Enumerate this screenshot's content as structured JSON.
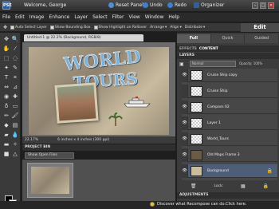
{
  "titlebar": {
    "app_icon": "PSE",
    "user": "Welcome, George",
    "reset_panels": "Reset Panels",
    "undo": "Undo",
    "redo": "Redo",
    "organizer": "Organizer"
  },
  "menu": [
    "File",
    "Edit",
    "Image",
    "Enhance",
    "Layer",
    "Select",
    "Filter",
    "View",
    "Window",
    "Help"
  ],
  "options": {
    "auto_select": "Auto Select Layer",
    "show_bounding": "Show Bounding Box",
    "show_highlight": "Show Highlight on Rollover",
    "arrange": "Arrange",
    "align": "Align",
    "distribute": "Distribute",
    "edit_tab": "Edit"
  },
  "document": {
    "tab_title": "Untitled-1 @ 22.2% (Background, RGB/8)",
    "artwork_text_1": "WORLD",
    "artwork_text_2": "TOURS",
    "zoom": "22.17%",
    "doc_info": "6 inches x 4 inches (300 ppi)"
  },
  "project_bin": {
    "header": "PROJECT BIN",
    "dropdown": "Show Open Files"
  },
  "panels": {
    "mode_tabs": [
      "Full",
      "Quick",
      "Guided"
    ],
    "sub_tabs": [
      "EFFECTS",
      "CONTENT"
    ],
    "layers_header": "LAYERS",
    "blend_mode": "Normal",
    "opacity": "Opacity: 100%",
    "layers": [
      {
        "name": "Cruise Ship copy",
        "visible": true,
        "selected": false
      },
      {
        "name": "Cruise Ship",
        "visible": false,
        "selected": false
      },
      {
        "name": "Compass 02",
        "visible": true,
        "selected": false
      },
      {
        "name": "Layer 1",
        "visible": true,
        "selected": false
      },
      {
        "name": "World_Tours",
        "visible": true,
        "selected": false
      },
      {
        "name": "Old Maps Frame 3",
        "visible": true,
        "selected": false
      },
      {
        "name": "Background",
        "visible": true,
        "selected": true
      }
    ],
    "layer_footer": {
      "lock": "Lock:"
    },
    "adjustments_header": "ADJUSTMENTS"
  },
  "statusbar": {
    "tip": "Discover what Recompose can do.Click here."
  },
  "colors": {
    "accent_blue": "#4e5e78",
    "panel_bg": "#3c3c3c"
  }
}
